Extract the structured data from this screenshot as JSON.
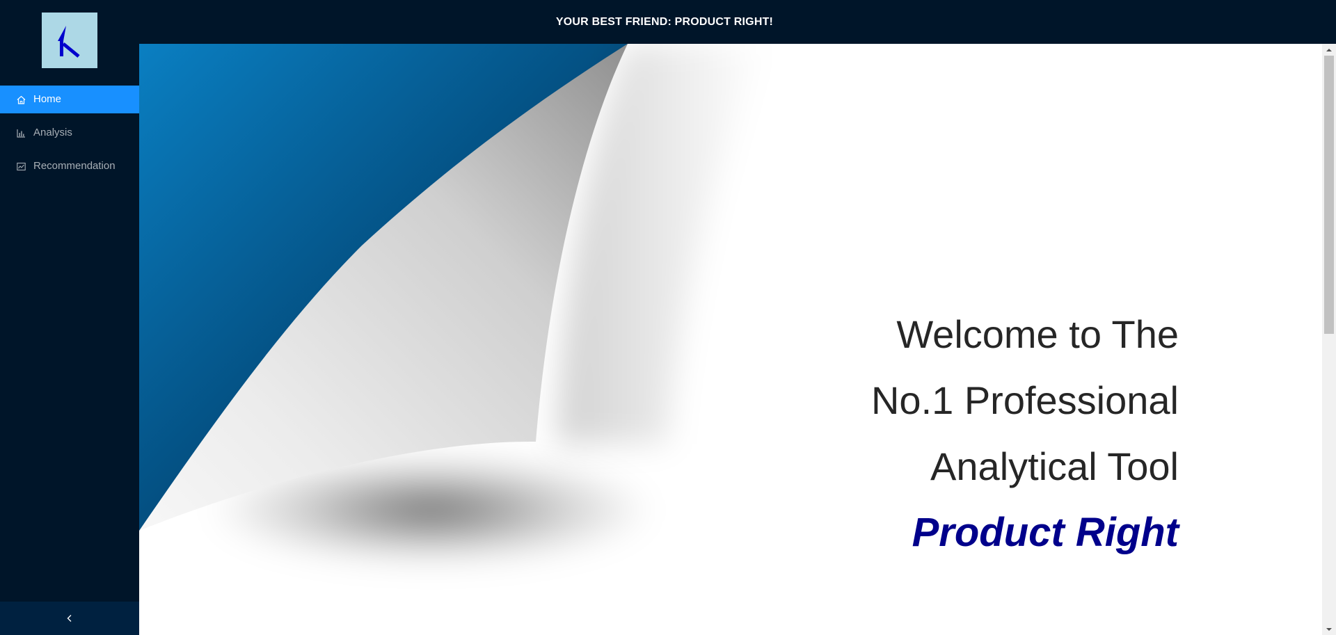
{
  "sidebar": {
    "logo_icon": "arrow-up-left-icon",
    "logo_colors": {
      "background": "#add8e6",
      "arrow": "#0000cd"
    },
    "items": [
      {
        "label": "Home",
        "icon": "home-icon",
        "selected": true
      },
      {
        "label": "Analysis",
        "icon": "bar-chart-icon",
        "selected": false
      },
      {
        "label": "Recommendation",
        "icon": "line-chart-icon",
        "selected": false
      }
    ],
    "collapse_icon": "chevron-left-icon"
  },
  "header": {
    "title": "YOUR BEST FRIEND: PRODUCT RIGHT!"
  },
  "main": {
    "welcome_lines": [
      "Welcome to The",
      "No.1 Professional",
      "Analytical Tool"
    ],
    "brand": "Product Right"
  },
  "colors": {
    "sidebar_bg": "#001529",
    "header_bg": "#001529",
    "accent": "#1890ff",
    "brand_text": "#00008b",
    "hero_blue": "#0a6aa8"
  }
}
